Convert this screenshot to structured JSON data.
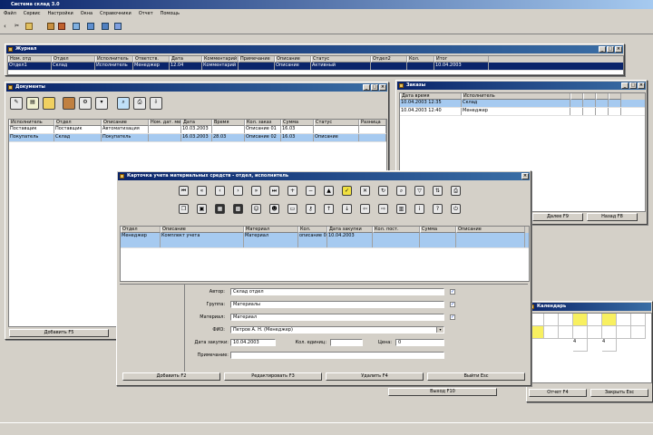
{
  "app": {
    "title": "Система склад 3.0",
    "menu": [
      "Файл",
      "Сервис",
      "Настройки",
      "Окна",
      "Справочники",
      "Отчет",
      "Помощь"
    ]
  },
  "win_top": {
    "title": "Журнал",
    "columns": [
      "Ном. отд",
      "Отдел",
      "Исполнитель",
      "Ответств.",
      "Дата",
      "Комментарий",
      "Примечание",
      "Описание",
      "Статус",
      "Отдел2",
      "Кол.",
      "Итог"
    ],
    "row": [
      "Отдел1",
      "Склад",
      "Исполнитель",
      "Менеджер",
      "12.04",
      "Комментарий",
      "",
      "Описание",
      "Активный",
      "",
      "",
      "10.04.2003"
    ]
  },
  "win_mid": {
    "title": "Документы",
    "columns": [
      "Исполнитель",
      "Отдел",
      "Описание",
      "Ном. дат. мест",
      "Дата",
      "Время",
      "Кол. заказ",
      "Сумма",
      "Статус",
      "Разница"
    ],
    "rows": [
      [
        "Поставщик",
        "Поставщик",
        "Автоматизация",
        "",
        "10.03.2003",
        "",
        "Описание 01",
        "16.03",
        "",
        ""
      ],
      [
        "Покупатель",
        "Склад",
        "Покупатель",
        "",
        "16.03.2003",
        "28.03",
        "Описание 02",
        "16.03",
        "Описание",
        ""
      ]
    ],
    "bottom_button": "Добавить F5"
  },
  "win_right": {
    "title": "Заказы",
    "columns": [
      "Дата время",
      "Исполнитель",
      "",
      "",
      "",
      ""
    ],
    "rows": [
      [
        "10.04.2003 12:35",
        "Склад",
        "",
        "",
        "",
        ""
      ],
      [
        "10.04.2003 12:40",
        "Менеджер",
        "",
        "",
        "",
        ""
      ]
    ],
    "buttons": [
      "Далее F9",
      "Назад F8",
      "Выход F10"
    ]
  },
  "win_cal": {
    "title": "Календарь",
    "buttons": [
      "Отчет F4",
      "Закрыть Esc"
    ],
    "cells": [
      "4",
      "4"
    ]
  },
  "dialog": {
    "title": "Карточка учета материальных средств - отдел, исполнитель",
    "columns": [
      "Отдел",
      "Описание",
      "Материал",
      "Кол.",
      "Дата закупки",
      "Кол. пост.",
      "Сумма",
      "Описание"
    ],
    "row": [
      "Менеджер",
      "Комплект учета",
      "Материал",
      "описание 01",
      "10.04.2003",
      "",
      "",
      ""
    ],
    "form": {
      "fields": [
        {
          "label": "Автор:",
          "value": "Склад отдел"
        },
        {
          "label": "Группа:",
          "value": "Материалы"
        },
        {
          "label": "Материал:",
          "value": "Материал"
        },
        {
          "label": "ФИО:",
          "value": "Петров А. Н. (Менеджер)"
        }
      ],
      "date_label": "Дата закупки:",
      "date_value": "10.04.2003",
      "qty_label": "Кол. единиц:",
      "qty_value": "",
      "price_label": "Цена:",
      "price_value": "0",
      "note_label": "Примечание:",
      "note_value": ""
    },
    "buttons": [
      "Добавить F2",
      "Редактировать F3",
      "Удалить F4",
      "Выйти Esc"
    ]
  },
  "colors": {
    "titlebar": "#0a246a",
    "window": "#d4d0c8",
    "selection": "#a6caf0",
    "highlight": "#f8f060"
  }
}
